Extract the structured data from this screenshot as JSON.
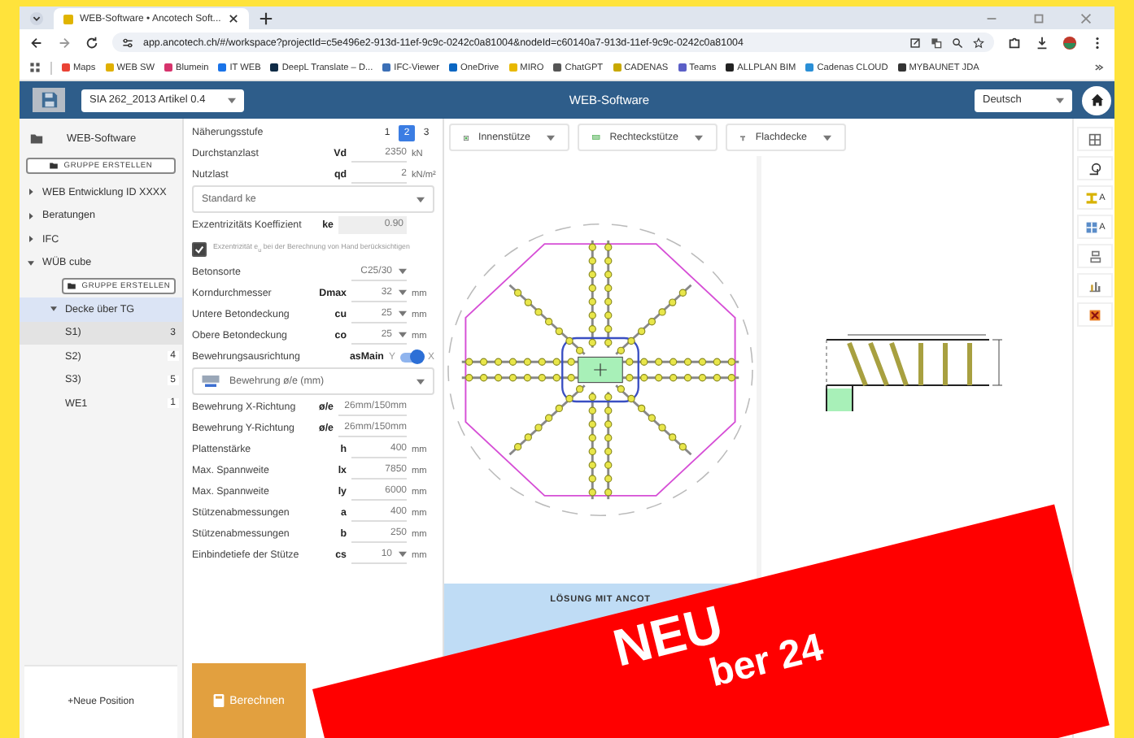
{
  "browser": {
    "tab_title": "WEB-Software • Ancotech Soft...",
    "url": "app.ancotech.ch/#/workspace?projectId=c5e496e2-913d-11ef-9c9c-0242c0a81004&nodeId=c60140a7-913d-11ef-9c9c-0242c0a81004",
    "bookmarks": [
      {
        "label": "Maps",
        "color": "#ea4335"
      },
      {
        "label": "WEB SW",
        "color": "#e0b000"
      },
      {
        "label": "Blumein",
        "color": "#d6336c"
      },
      {
        "label": "IT WEB",
        "color": "#1a73e8"
      },
      {
        "label": "DeepL Translate – D...",
        "color": "#0f2b46"
      },
      {
        "label": "IFC-Viewer",
        "color": "#3b6fb6"
      },
      {
        "label": "OneDrive",
        "color": "#0a66c2"
      },
      {
        "label": "MIRO",
        "color": "#e8b800"
      },
      {
        "label": "ChatGPT",
        "color": "#555555"
      },
      {
        "label": "CADENAS",
        "color": "#c8a800"
      },
      {
        "label": "Teams",
        "color": "#5b5fc7"
      },
      {
        "label": "ALLPLAN BIM",
        "color": "#222222"
      },
      {
        "label": "Cadenas CLOUD",
        "color": "#2a8fd6"
      },
      {
        "label": "MYBAUNET JDA",
        "color": "#333333"
      }
    ]
  },
  "header": {
    "project": "SIA 262_2013 Artikel 0.4",
    "title": "WEB-Software",
    "language": "Deutsch"
  },
  "sidebar": {
    "title": "WEB-Software",
    "create_button": "GRUPPE ERSTELLEN",
    "tree": [
      {
        "kind": "group",
        "label": "WEB Entwicklung ID XXXX",
        "expanded": false,
        "selected": false
      },
      {
        "kind": "group",
        "label": "Beratungen",
        "expanded": false,
        "selected": false
      },
      {
        "kind": "group",
        "label": "IFC",
        "expanded": false,
        "selected": false
      },
      {
        "kind": "group",
        "label": "WÜB cube",
        "expanded": true,
        "selected": false,
        "children": [
          {
            "kind": "button",
            "label": "GRUPPE ERSTELLEN"
          },
          {
            "kind": "group",
            "label": "Decke über TG",
            "expanded": true,
            "selected": true,
            "children": [
              {
                "kind": "position",
                "label": "S1)",
                "count": "3",
                "selected": true
              },
              {
                "kind": "position",
                "label": "S2)",
                "count": "4",
                "selected": false
              },
              {
                "kind": "position",
                "label": "S3)",
                "count": "5",
                "selected": false
              },
              {
                "kind": "position",
                "label": "WE1",
                "count": "1",
                "selected": false
              }
            ]
          }
        ]
      }
    ],
    "new_button": "+Neue Position"
  },
  "form": {
    "rows": [
      {
        "kind": "stepper",
        "label": "Näherungsstufe",
        "steps": [
          {
            "label": "1",
            "selected": false
          },
          {
            "label": "2",
            "selected": true
          },
          {
            "label": "3",
            "selected": false
          }
        ]
      },
      {
        "kind": "value",
        "label": "Durchstanzlast",
        "symbol": "Vd",
        "value": "2350",
        "unit": "kN"
      },
      {
        "kind": "value",
        "label": "Nutzlast",
        "symbol": "qd",
        "value": "2",
        "unit": "kN/m²"
      },
      {
        "kind": "select",
        "value": "Standard ke"
      },
      {
        "kind": "value",
        "label": "Exzentrizitäts Koeffizient",
        "symbol": "ke",
        "value": "0.90",
        "disabled": true
      },
      {
        "kind": "checkbox",
        "label": "Exzentrizität e$_{u}$ bei der Berechnung von Hand berücksichtigen",
        "checked": true
      },
      {
        "kind": "value",
        "label": "Betonsorte",
        "value": "C25/30",
        "dropdown": true
      },
      {
        "kind": "value",
        "label": "Korndurchmesser",
        "symbol": "Dmax",
        "value": "32",
        "unit": "mm",
        "dropdown": true
      },
      {
        "kind": "value",
        "label": "Untere Betondeckung",
        "symbol": "cu",
        "value": "25",
        "unit": "mm",
        "dropdown": true
      },
      {
        "kind": "value",
        "label": "Obere Betondeckung",
        "symbol": "co",
        "value": "25",
        "unit": "mm",
        "dropdown": true
      },
      {
        "kind": "toggle",
        "label": "Bewehrungsausrichtung",
        "symbol": "asMain",
        "left": "Y",
        "right": "X",
        "on": true
      },
      {
        "kind": "select",
        "value": "Bewehrung ø/e (mm)",
        "icon": true
      },
      {
        "kind": "value",
        "label": "Bewehrung X-Richtung",
        "symbol": "ø/e",
        "value": "26mm/150mm"
      },
      {
        "kind": "value",
        "label": "Bewehrung Y-Richtung",
        "symbol": "ø/e",
        "value": "26mm/150mm"
      },
      {
        "kind": "value",
        "label": "Plattenstärke",
        "symbol": "h",
        "value": "400",
        "unit": "mm"
      },
      {
        "kind": "value",
        "label": "Max. Spannweite",
        "symbol": "lx",
        "value": "7850",
        "unit": "mm"
      },
      {
        "kind": "value",
        "label": "Max. Spannweite",
        "symbol": "ly",
        "value": "6000",
        "unit": "mm"
      },
      {
        "kind": "value",
        "label": "Stützenabmessungen",
        "symbol": "a",
        "value": "400",
        "unit": "mm"
      },
      {
        "kind": "value",
        "label": "Stützenabmessungen",
        "symbol": "b",
        "value": "250",
        "unit": "mm"
      },
      {
        "kind": "value",
        "label": "Einbindetiefe der Stütze",
        "symbol": "cs",
        "value": "10",
        "unit": "mm",
        "dropdown": true
      }
    ],
    "calculate_button": "Berechnen"
  },
  "toolbar": [
    {
      "label": "Innenstütze",
      "kind": "column"
    },
    {
      "label": "Rechteckstütze",
      "kind": "rect"
    },
    {
      "label": "Flachdecke",
      "kind": "slab"
    }
  ],
  "solution_bar": "LÖSUNG MIT ANCOT",
  "side_tools": [
    {
      "kind": "grid"
    },
    {
      "kind": "shape"
    },
    {
      "kind": "beam",
      "label": "A"
    },
    {
      "kind": "table",
      "label": "A"
    },
    {
      "kind": "split"
    },
    {
      "kind": "chart"
    },
    {
      "kind": "delete"
    }
  ],
  "banner": {
    "title": "NEU",
    "subtitle": "ber 24"
  }
}
